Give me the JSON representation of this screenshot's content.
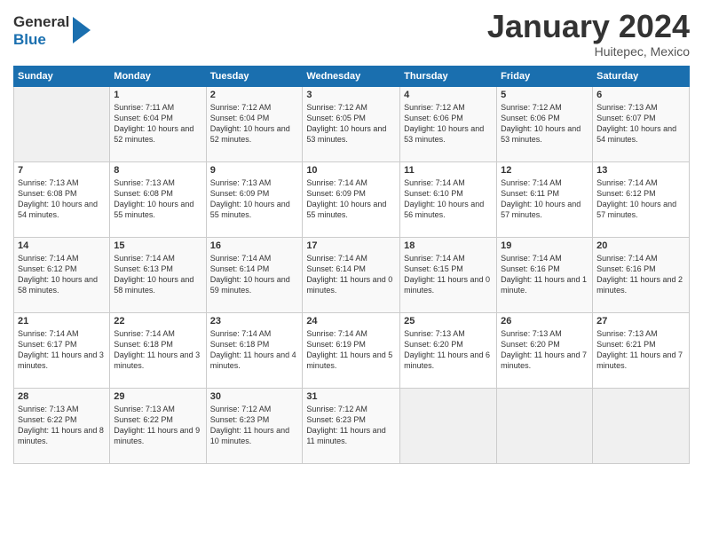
{
  "header": {
    "logo": {
      "line1": "General",
      "line2": "Blue"
    },
    "title": "January 2024",
    "subtitle": "Huitepec, Mexico"
  },
  "columns": [
    "Sunday",
    "Monday",
    "Tuesday",
    "Wednesday",
    "Thursday",
    "Friday",
    "Saturday"
  ],
  "weeks": [
    [
      {
        "day": "",
        "sunrise": "",
        "sunset": "",
        "daylight": ""
      },
      {
        "day": "1",
        "sunrise": "Sunrise: 7:11 AM",
        "sunset": "Sunset: 6:04 PM",
        "daylight": "Daylight: 10 hours and 52 minutes."
      },
      {
        "day": "2",
        "sunrise": "Sunrise: 7:12 AM",
        "sunset": "Sunset: 6:04 PM",
        "daylight": "Daylight: 10 hours and 52 minutes."
      },
      {
        "day": "3",
        "sunrise": "Sunrise: 7:12 AM",
        "sunset": "Sunset: 6:05 PM",
        "daylight": "Daylight: 10 hours and 53 minutes."
      },
      {
        "day": "4",
        "sunrise": "Sunrise: 7:12 AM",
        "sunset": "Sunset: 6:06 PM",
        "daylight": "Daylight: 10 hours and 53 minutes."
      },
      {
        "day": "5",
        "sunrise": "Sunrise: 7:12 AM",
        "sunset": "Sunset: 6:06 PM",
        "daylight": "Daylight: 10 hours and 53 minutes."
      },
      {
        "day": "6",
        "sunrise": "Sunrise: 7:13 AM",
        "sunset": "Sunset: 6:07 PM",
        "daylight": "Daylight: 10 hours and 54 minutes."
      }
    ],
    [
      {
        "day": "7",
        "sunrise": "Sunrise: 7:13 AM",
        "sunset": "Sunset: 6:08 PM",
        "daylight": "Daylight: 10 hours and 54 minutes."
      },
      {
        "day": "8",
        "sunrise": "Sunrise: 7:13 AM",
        "sunset": "Sunset: 6:08 PM",
        "daylight": "Daylight: 10 hours and 55 minutes."
      },
      {
        "day": "9",
        "sunrise": "Sunrise: 7:13 AM",
        "sunset": "Sunset: 6:09 PM",
        "daylight": "Daylight: 10 hours and 55 minutes."
      },
      {
        "day": "10",
        "sunrise": "Sunrise: 7:14 AM",
        "sunset": "Sunset: 6:09 PM",
        "daylight": "Daylight: 10 hours and 55 minutes."
      },
      {
        "day": "11",
        "sunrise": "Sunrise: 7:14 AM",
        "sunset": "Sunset: 6:10 PM",
        "daylight": "Daylight: 10 hours and 56 minutes."
      },
      {
        "day": "12",
        "sunrise": "Sunrise: 7:14 AM",
        "sunset": "Sunset: 6:11 PM",
        "daylight": "Daylight: 10 hours and 57 minutes."
      },
      {
        "day": "13",
        "sunrise": "Sunrise: 7:14 AM",
        "sunset": "Sunset: 6:12 PM",
        "daylight": "Daylight: 10 hours and 57 minutes."
      }
    ],
    [
      {
        "day": "14",
        "sunrise": "Sunrise: 7:14 AM",
        "sunset": "Sunset: 6:12 PM",
        "daylight": "Daylight: 10 hours and 58 minutes."
      },
      {
        "day": "15",
        "sunrise": "Sunrise: 7:14 AM",
        "sunset": "Sunset: 6:13 PM",
        "daylight": "Daylight: 10 hours and 58 minutes."
      },
      {
        "day": "16",
        "sunrise": "Sunrise: 7:14 AM",
        "sunset": "Sunset: 6:14 PM",
        "daylight": "Daylight: 10 hours and 59 minutes."
      },
      {
        "day": "17",
        "sunrise": "Sunrise: 7:14 AM",
        "sunset": "Sunset: 6:14 PM",
        "daylight": "Daylight: 11 hours and 0 minutes."
      },
      {
        "day": "18",
        "sunrise": "Sunrise: 7:14 AM",
        "sunset": "Sunset: 6:15 PM",
        "daylight": "Daylight: 11 hours and 0 minutes."
      },
      {
        "day": "19",
        "sunrise": "Sunrise: 7:14 AM",
        "sunset": "Sunset: 6:16 PM",
        "daylight": "Daylight: 11 hours and 1 minute."
      },
      {
        "day": "20",
        "sunrise": "Sunrise: 7:14 AM",
        "sunset": "Sunset: 6:16 PM",
        "daylight": "Daylight: 11 hours and 2 minutes."
      }
    ],
    [
      {
        "day": "21",
        "sunrise": "Sunrise: 7:14 AM",
        "sunset": "Sunset: 6:17 PM",
        "daylight": "Daylight: 11 hours and 3 minutes."
      },
      {
        "day": "22",
        "sunrise": "Sunrise: 7:14 AM",
        "sunset": "Sunset: 6:18 PM",
        "daylight": "Daylight: 11 hours and 3 minutes."
      },
      {
        "day": "23",
        "sunrise": "Sunrise: 7:14 AM",
        "sunset": "Sunset: 6:18 PM",
        "daylight": "Daylight: 11 hours and 4 minutes."
      },
      {
        "day": "24",
        "sunrise": "Sunrise: 7:14 AM",
        "sunset": "Sunset: 6:19 PM",
        "daylight": "Daylight: 11 hours and 5 minutes."
      },
      {
        "day": "25",
        "sunrise": "Sunrise: 7:13 AM",
        "sunset": "Sunset: 6:20 PM",
        "daylight": "Daylight: 11 hours and 6 minutes."
      },
      {
        "day": "26",
        "sunrise": "Sunrise: 7:13 AM",
        "sunset": "Sunset: 6:20 PM",
        "daylight": "Daylight: 11 hours and 7 minutes."
      },
      {
        "day": "27",
        "sunrise": "Sunrise: 7:13 AM",
        "sunset": "Sunset: 6:21 PM",
        "daylight": "Daylight: 11 hours and 7 minutes."
      }
    ],
    [
      {
        "day": "28",
        "sunrise": "Sunrise: 7:13 AM",
        "sunset": "Sunset: 6:22 PM",
        "daylight": "Daylight: 11 hours and 8 minutes."
      },
      {
        "day": "29",
        "sunrise": "Sunrise: 7:13 AM",
        "sunset": "Sunset: 6:22 PM",
        "daylight": "Daylight: 11 hours and 9 minutes."
      },
      {
        "day": "30",
        "sunrise": "Sunrise: 7:12 AM",
        "sunset": "Sunset: 6:23 PM",
        "daylight": "Daylight: 11 hours and 10 minutes."
      },
      {
        "day": "31",
        "sunrise": "Sunrise: 7:12 AM",
        "sunset": "Sunset: 6:23 PM",
        "daylight": "Daylight: 11 hours and 11 minutes."
      },
      {
        "day": "",
        "sunrise": "",
        "sunset": "",
        "daylight": ""
      },
      {
        "day": "",
        "sunrise": "",
        "sunset": "",
        "daylight": ""
      },
      {
        "day": "",
        "sunrise": "",
        "sunset": "",
        "daylight": ""
      }
    ]
  ]
}
